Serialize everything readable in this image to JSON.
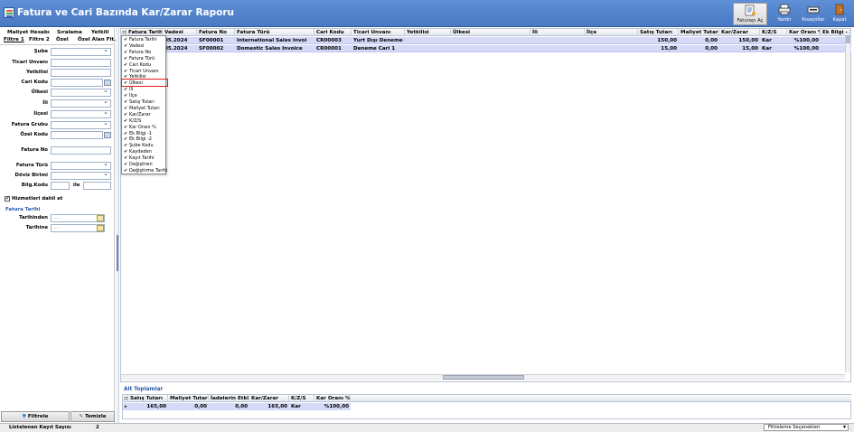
{
  "window": {
    "title": "Fatura ve Cari Bazında Kar/Zarar Raporu"
  },
  "toolbar": {
    "buttons": [
      {
        "label": "Faturayı Aç",
        "icon": "document-open-icon"
      },
      {
        "label": "Yazdır",
        "icon": "printer-icon"
      },
      {
        "label": "Kısayollar",
        "icon": "keyboard-icon"
      },
      {
        "label": "Kapat",
        "icon": "exit-door-icon"
      }
    ]
  },
  "left_tabs": {
    "row1": [
      "Maliyet Hesabı",
      "Sıralama",
      "Yetkili"
    ],
    "row2": [
      "Filtre 1",
      "Filtre 2",
      "Özel",
      "Özel Alan Flt."
    ]
  },
  "filters": {
    "fields": [
      "Şube",
      "Ticari Unvanı",
      "Yetkilisi",
      "Cari Kodu",
      "Ülkesi",
      "İli",
      "İlçesi",
      "Fatura Grubu",
      "Özel Kodu",
      "Fatura No",
      "Fatura Türü",
      "Döviz Birimi",
      "Bilg.Kodu"
    ],
    "bilg_kodu_separator": "ile",
    "include_services_label": "Hizmetleri dahil et",
    "date_section_title": "Fatura Tarihi",
    "date_from_label": "Tarihinden",
    "date_to_label": "Tarihine",
    "date_from_value": " .  .",
    "date_to_value": " .  ."
  },
  "left_buttons": {
    "filter": "Filtrele",
    "clear": "Temizle"
  },
  "grid": {
    "columns": [
      "Fatura Tarihi",
      "Vadesi",
      "Fatura No",
      "Fatura Türü",
      "Cari Kodu",
      "Ticari Unvanı",
      "Yetkilisi",
      "Ülkesi",
      "İli",
      "İlçe",
      "Satış Tutarı",
      "Maliyet Tutarı",
      "Kar/Zarar",
      "K/Z/S",
      "Kar Oranı %",
      "Ek Bilgi - 1"
    ],
    "rows": [
      [
        "",
        "05.2024",
        "SF00001",
        "International Sales Invoi",
        "CR00003",
        "Yurt Dışı Deneme Cari",
        "",
        "",
        "",
        "",
        "150,00",
        "0,00",
        "150,00",
        "Kar",
        "%100,00",
        ""
      ],
      [
        "",
        "05.2024",
        "SF00002",
        "Domestic Sales Invoice",
        "CR00001",
        "Deneme Cari 1",
        "",
        "",
        "",
        "",
        "15,00",
        "0,00",
        "15,00",
        "Kar",
        "%100,00",
        ""
      ]
    ]
  },
  "column_chooser": {
    "items": [
      "Fatura Tarihi",
      "Vadesi",
      "Fatura No",
      "Fatura Türü",
      "Cari Kodu",
      "Ticari Unvanı",
      "Yetkilisi",
      "Ülkesi",
      "İli",
      "İlçe",
      "Satış Tutarı",
      "Maliyet Tutarı",
      "Kar/Zarar",
      "K/Z/S",
      "Kar Oranı %",
      "Ek Bilgi -1",
      "Ek Bilgi -2",
      "Şube Kodu",
      "Kaydeden",
      "Kayıt Tarihi",
      "Değiştiren",
      "Değiştirme Tarihi"
    ],
    "check_mark": "✔",
    "highlighted_item": "Ülkesi"
  },
  "totals": {
    "title": "Alt Toplamlar",
    "columns": [
      "Satış Tutarı",
      "Maliyet Tutarı",
      "İadelerin Etkisi",
      "Kar/Zarar",
      "K/Z/S",
      "Kar Oranı %"
    ],
    "values": [
      "165,00",
      "0,00",
      "0,00",
      "165,00",
      "Kar",
      "%100,00"
    ]
  },
  "status": {
    "record_count_label": "Listelenen Kayıt Sayısı",
    "record_count": "2",
    "filter_options": "Filtreleme Seçenekleri"
  }
}
